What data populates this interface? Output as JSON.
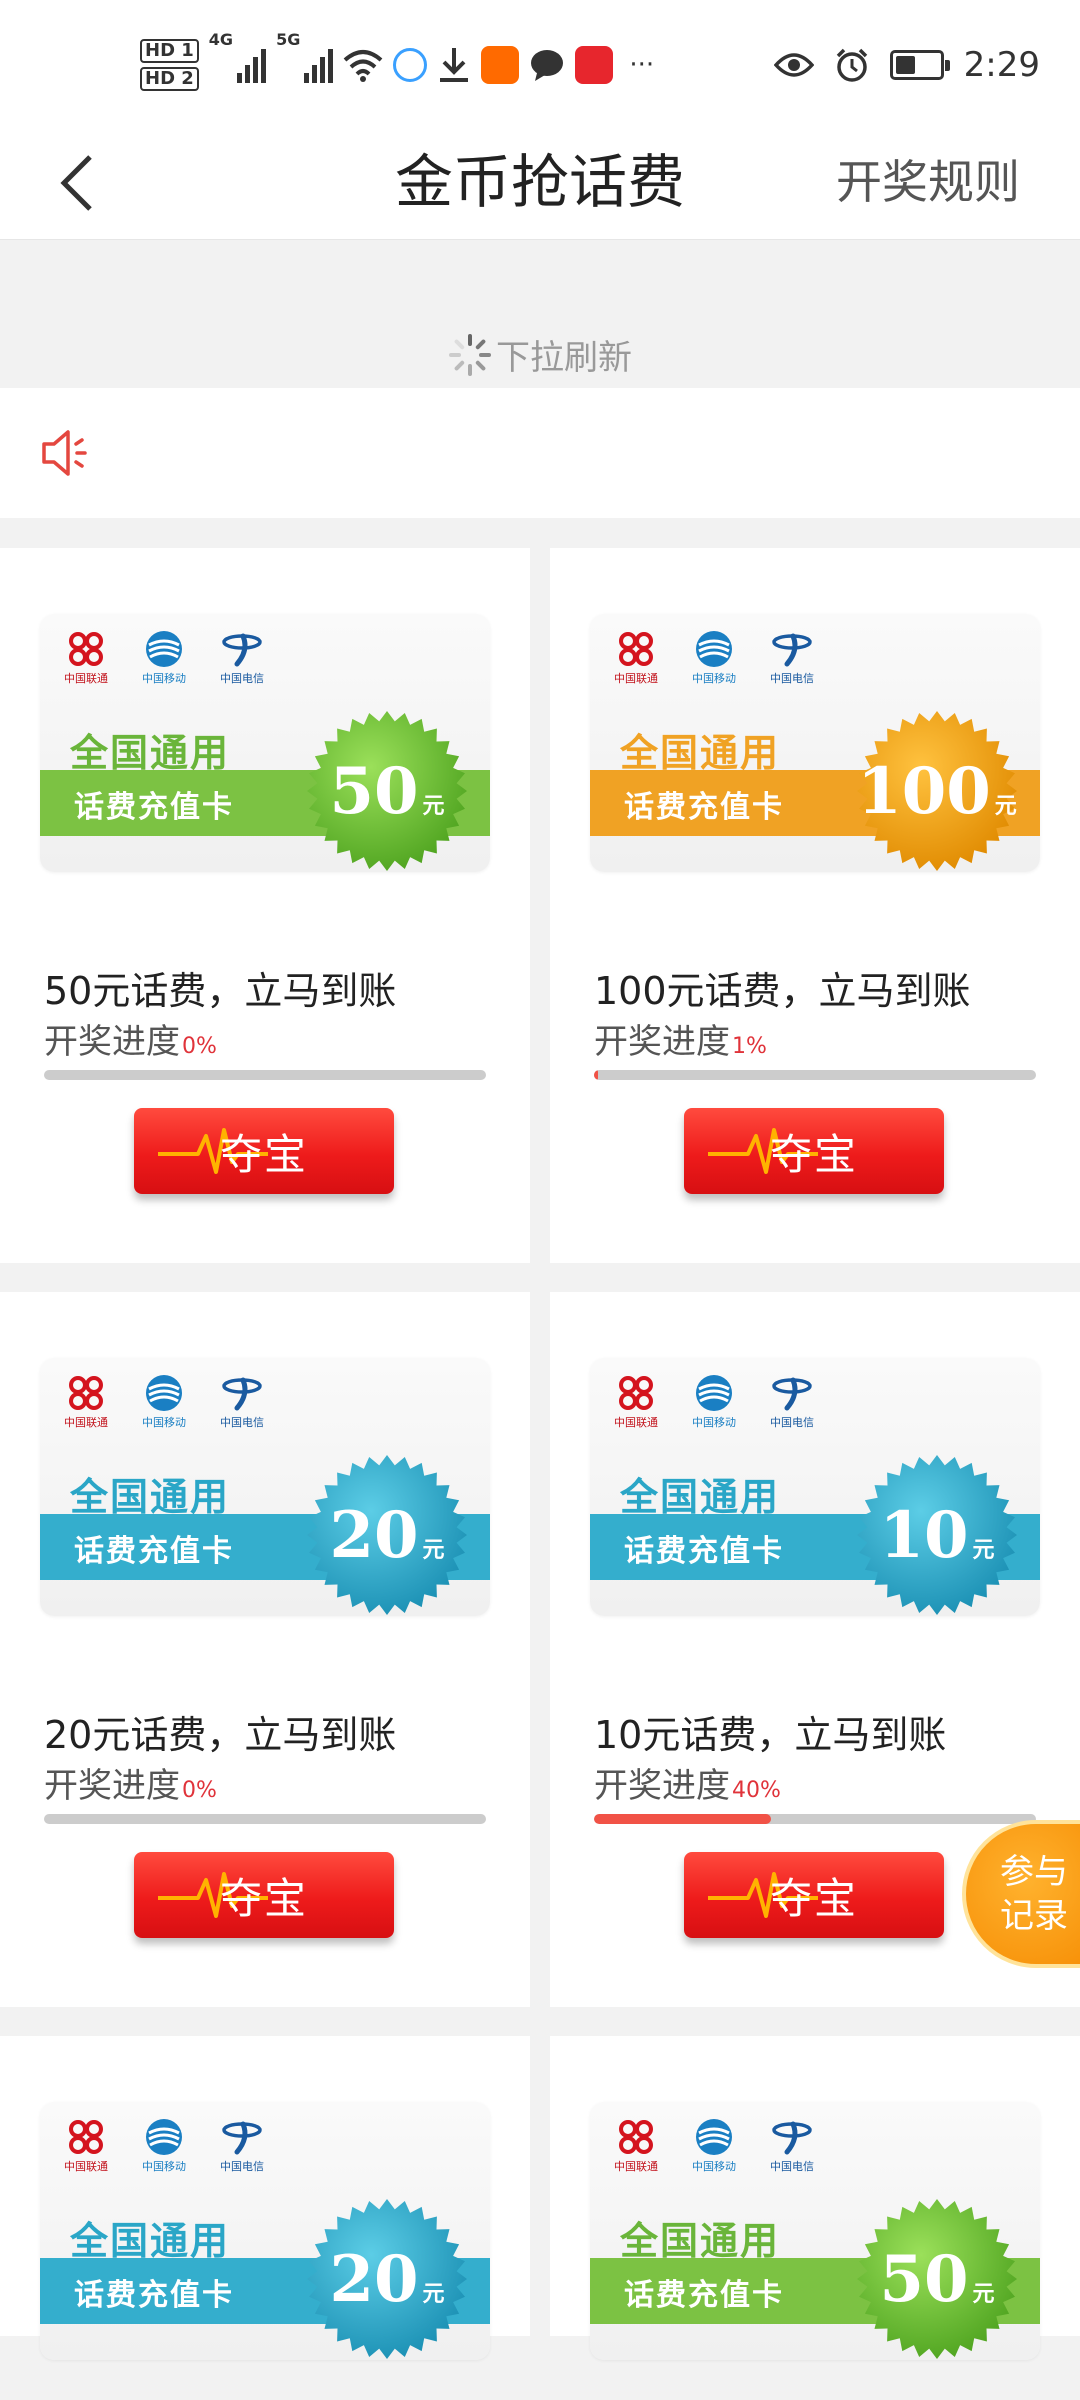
{
  "status_bar": {
    "sim1": "HD 1",
    "sim2": "HD 2",
    "net1": "4G",
    "net2": "5G",
    "more": "···",
    "time": "2:29",
    "icons": [
      "signal-icon",
      "wifi-icon",
      "browser-icon",
      "download-icon",
      "app-icon",
      "chat-icon",
      "app-icon",
      "eye-icon",
      "alarm-icon",
      "battery-icon"
    ]
  },
  "header": {
    "title": "金币抢话费",
    "rules": "开奖规则"
  },
  "refresh": {
    "label": "下拉刷新"
  },
  "cards": [
    {
      "title": "50元话费，立马到账",
      "progress_label": "开奖进度",
      "progress_pct": "0%",
      "progress": 0,
      "button": "夺宝",
      "badge_top": "全国通用",
      "badge_band": "话费充值卡",
      "amount": "50",
      "unit": "元",
      "theme": "green"
    },
    {
      "title": "100元话费，立马到账",
      "progress_label": "开奖进度",
      "progress_pct": "1%",
      "progress": 1,
      "button": "夺宝",
      "badge_top": "全国通用",
      "badge_band": "话费充值卡",
      "amount": "100",
      "unit": "元",
      "theme": "orange"
    },
    {
      "title": "20元话费，立马到账",
      "progress_label": "开奖进度",
      "progress_pct": "0%",
      "progress": 0,
      "button": "夺宝",
      "badge_top": "全国通用",
      "badge_band": "话费充值卡",
      "amount": "20",
      "unit": "元",
      "theme": "blue"
    },
    {
      "title": "10元话费，立马到账",
      "progress_label": "开奖进度",
      "progress_pct": "40%",
      "progress": 40,
      "button": "夺宝",
      "badge_top": "全国通用",
      "badge_band": "话费充值卡",
      "amount": "10",
      "unit": "元",
      "theme": "blue"
    },
    {
      "badge_top": "全国通用",
      "badge_band": "话费充值卡",
      "amount": "20",
      "unit": "元",
      "theme": "blue"
    },
    {
      "badge_top": "全国通用",
      "badge_band": "话费充值卡",
      "amount": "50",
      "unit": "元",
      "theme": "green"
    }
  ],
  "carriers": [
    "中国联通",
    "中国移动",
    "中国电信"
  ],
  "float_button": "参与记录",
  "colors": {
    "accent_red": "#ee1b1b",
    "green": "#7cc243",
    "orange": "#f0a224",
    "blue": "#34aecd"
  }
}
